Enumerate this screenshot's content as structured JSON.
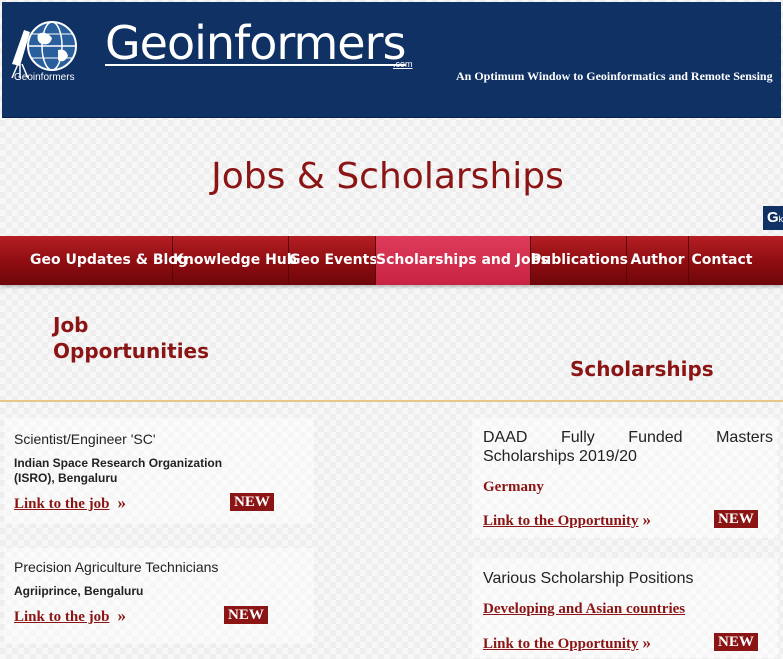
{
  "header": {
    "logo_text": "Geoinformers",
    "title": "Geoinformers",
    "title_suffix": ".com",
    "tagline": "An Optimum Window to Geoinformatics and Remote Sensing"
  },
  "page": {
    "heading": "Jobs & Scholarships",
    "badge_main": "G",
    "badge_sub": "k"
  },
  "nav": {
    "items": [
      {
        "label": "Geo Updates & Blog"
      },
      {
        "label": "Knowledge Hub"
      },
      {
        "label": "Geo Events"
      },
      {
        "label": "Scholarships and Jobs",
        "active": true
      },
      {
        "label": "Publications"
      },
      {
        "label": "Author"
      },
      {
        "label": "Contact"
      }
    ]
  },
  "jobs": {
    "heading_line1": "Job",
    "heading_line2": "Opportunities",
    "items": [
      {
        "title": "Scientist/Engineer 'SC'",
        "org_line1": "Indian Space Research Organization",
        "org_line2": "(ISRO), Bengaluru",
        "link": "Link to the job",
        "badge": "NEW"
      },
      {
        "title": "Precision Agriculture Technicians",
        "org_line1": "Agriiprince, Bengaluru",
        "link": "Link to the job",
        "badge": "NEW"
      }
    ]
  },
  "scholarships": {
    "heading": "Scholarships",
    "items": [
      {
        "title_line1": "DAAD Fully Funded Masters",
        "title_line2": "Scholarships 2019/20",
        "region": "Germany",
        "link": "Link to the Opportunity",
        "badge": "NEW"
      },
      {
        "title_line1": "Various Scholarship Positions",
        "region": "Developing and Asian countries",
        "link": "Link to the Opportunity",
        "badge": "NEW"
      }
    ]
  },
  "colors": {
    "header_bg": "#0f3163",
    "accent_red": "#8b1515",
    "nav_active": "#d22f4f"
  },
  "icons": [
    "globe-logo-icon",
    "double-chevron-right-icon"
  ]
}
